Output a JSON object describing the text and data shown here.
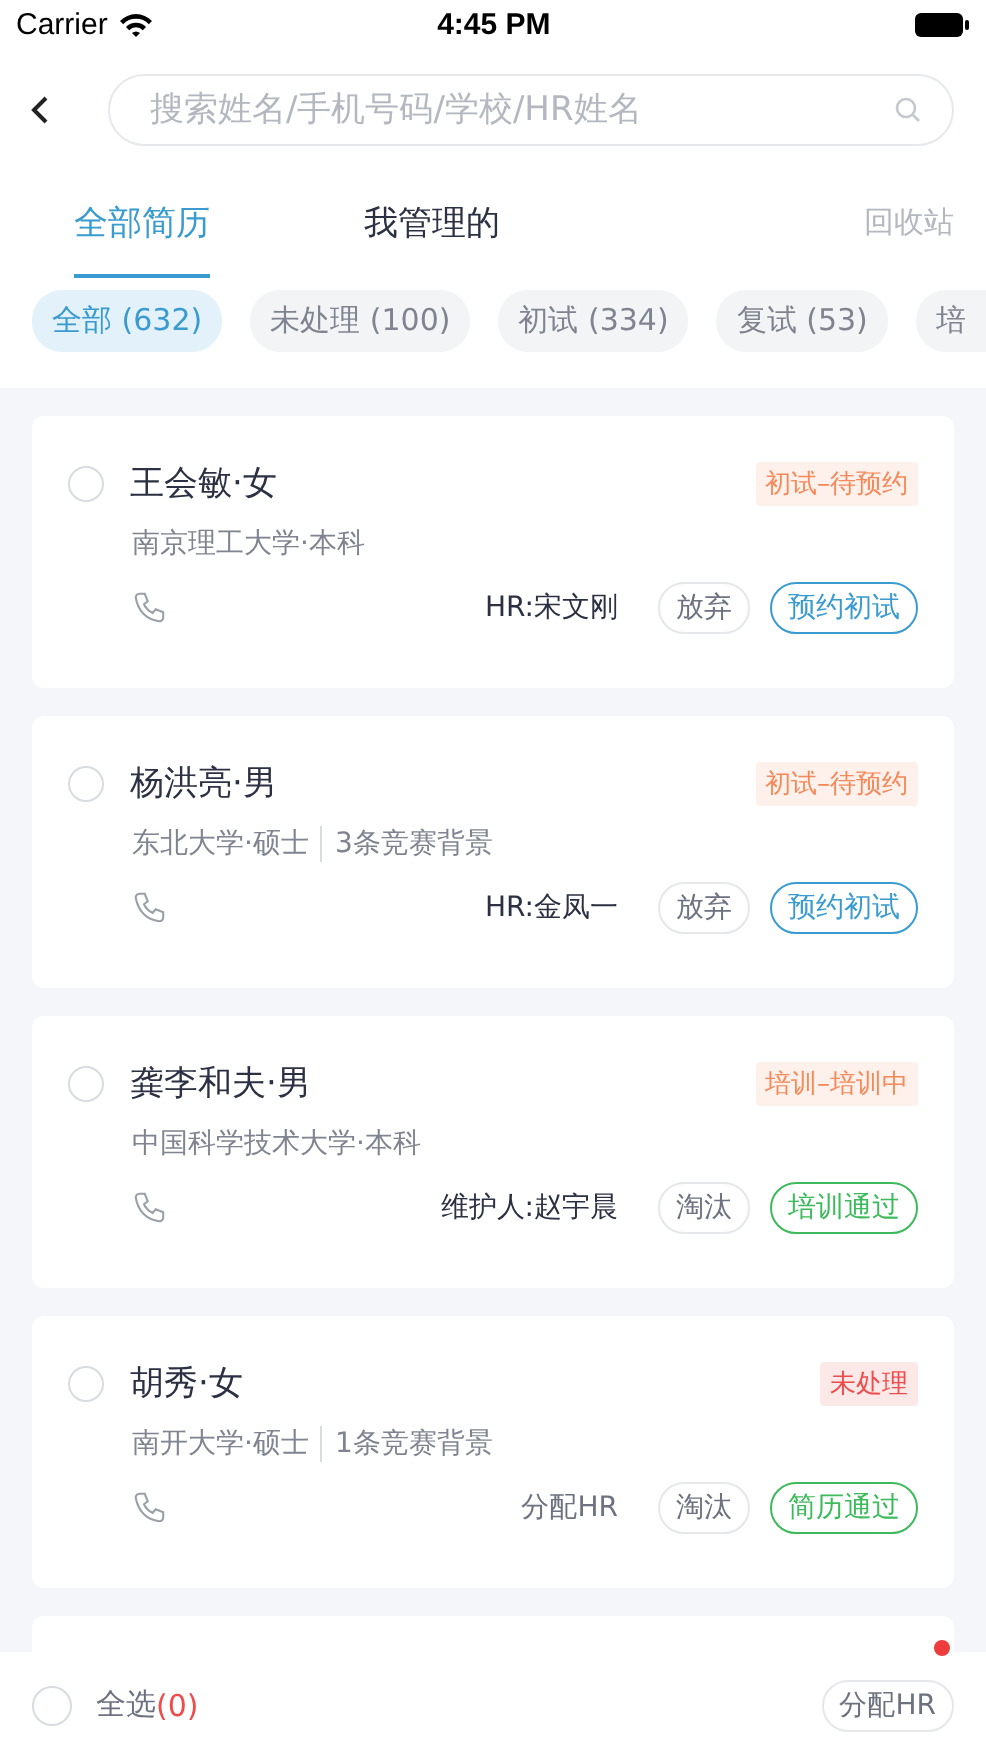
{
  "status_bar": {
    "carrier": "Carrier",
    "time": "4:45 PM"
  },
  "search": {
    "placeholder": "搜索姓名/手机号码/学校/HR姓名"
  },
  "tabs": [
    {
      "label": "全部简历",
      "selected": true
    },
    {
      "label": "我管理的",
      "selected": false
    }
  ],
  "recycle_link": "回收站",
  "filters": [
    {
      "label": "全部 (632)",
      "selected": true
    },
    {
      "label": "未处理 (100)",
      "selected": false
    },
    {
      "label": "初试 (334)",
      "selected": false
    },
    {
      "label": "复试 (53)",
      "selected": false
    },
    {
      "label": "培",
      "selected": false
    }
  ],
  "candidates": [
    {
      "name": "王会敏·女",
      "school": "南京理工大学·本科",
      "status": {
        "text": "初试–待预约",
        "color": "#f5895a"
      },
      "owner": "HR:宋文刚",
      "owner_assigned": true,
      "secondary_action": "放弃",
      "primary_action": {
        "label": "预约初试",
        "color": "#3a9bd0"
      },
      "checked": false
    },
    {
      "name": "杨洪亮·男",
      "school": "东北大学·硕士",
      "extra": "3条竞赛背景",
      "status": {
        "text": "初试–待预约",
        "color": "#f5895a"
      },
      "owner": "HR:金凤一",
      "owner_assigned": true,
      "secondary_action": "放弃",
      "primary_action": {
        "label": "预约初试",
        "color": "#3a9bd0"
      },
      "checked": false
    },
    {
      "name": "龚李和夫·男",
      "school": "中国科学技术大学·本科",
      "status": {
        "text": "培训–培训中",
        "color": "#f5895a"
      },
      "owner": "维护人:赵宇晨",
      "owner_assigned": true,
      "secondary_action": "淘汰",
      "primary_action": {
        "label": "培训通过",
        "color": "#3dba5c"
      },
      "checked": false
    },
    {
      "name": "胡秀·女",
      "school": "南开大学·硕士",
      "extra": "1条竞赛背景",
      "status": {
        "text": "未处理",
        "color": "#ee4b4b"
      },
      "owner": "分配HR",
      "owner_assigned": false,
      "secondary_action": "淘汰",
      "primary_action": {
        "label": "简历通过",
        "color": "#3dba5c"
      },
      "checked": false
    }
  ],
  "bottom_bar": {
    "select_all": "全选",
    "selected_count": "(0)",
    "checked": false,
    "assign_button": "分配HR",
    "notification_dot": true
  }
}
